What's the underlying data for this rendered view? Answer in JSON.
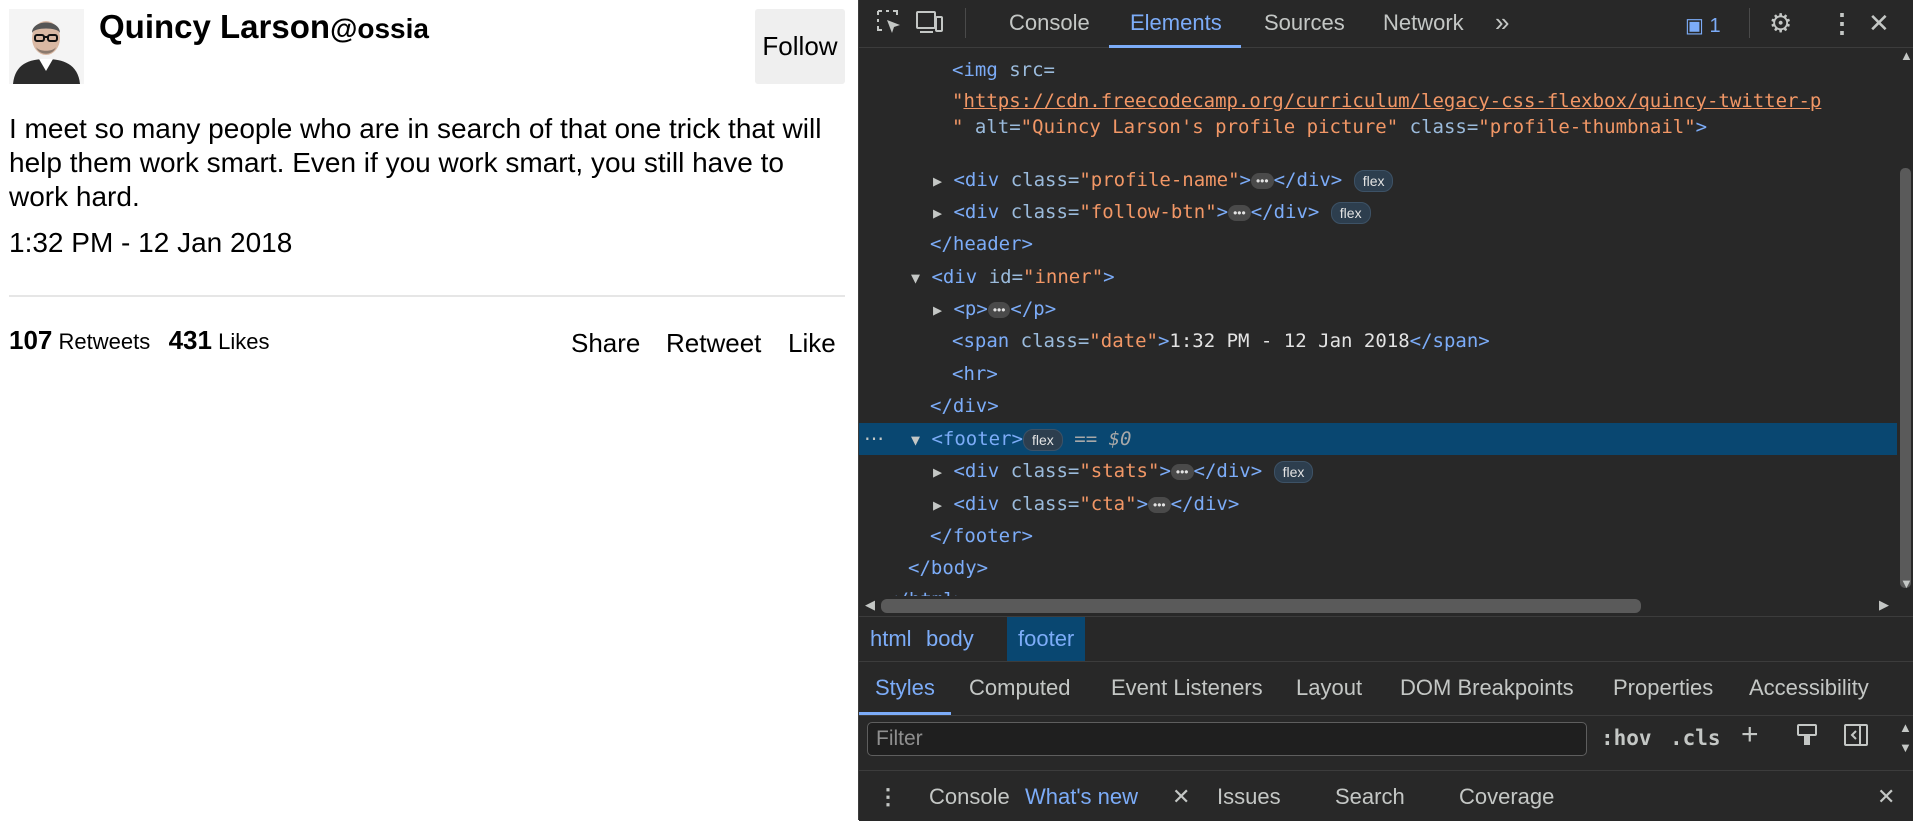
{
  "page": {
    "profile": {
      "name": "Quincy Larson",
      "handle": "@ossia",
      "follow_label": "Follow",
      "avatar_icon": "person-avatar-icon"
    },
    "tweet": "I meet so many people who are in search of that one trick that will help them work smart. Even if you work smart, you still have to work hard.",
    "date": "1:32 PM - 12 Jan 2018",
    "stats": {
      "retweets_count": "107",
      "retweets_label": "Retweets",
      "likes_count": "431",
      "likes_label": "Likes"
    },
    "cta": [
      "Share",
      "Retweet",
      "Like"
    ]
  },
  "devtools": {
    "toolbar": {
      "inspect_icon": "element-picker-icon",
      "device_icon": "device-toolbar-icon",
      "tabs": [
        "Console",
        "Elements",
        "Sources",
        "Network"
      ],
      "active_tab": "Elements",
      "more_tabs_icon": "double-chevron-icon",
      "issues_count": "1",
      "settings_icon": "gear-icon",
      "menu_icon": "kebab-menu-icon",
      "close_icon": "close-icon"
    },
    "dom": {
      "img_src_attr": "src=",
      "img_src_url": "https://cdn.freecodecamp.org/curriculum/legacy-css-flexbox/quincy-twitter-p",
      "img_alt_value": "Quincy Larson's profile picture",
      "img_class_value": "profile-thumbnail",
      "profile_name_class": "profile-name",
      "follow_btn_class": "follow-btn",
      "inner_id": "inner",
      "date_class": "date",
      "date_text": "1:32 PM - 12 Jan 2018",
      "stats_class": "stats",
      "cta_class": "cta",
      "flex_badge": "flex",
      "selected_marker": "== $0"
    },
    "breadcrumbs": [
      "html",
      "body",
      "footer"
    ],
    "styles_tabs": [
      "Styles",
      "Computed",
      "Event Listeners",
      "Layout",
      "DOM Breakpoints",
      "Properties",
      "Accessibility"
    ],
    "filter": {
      "placeholder": "Filter",
      "hov": ":hov",
      "cls": ".cls"
    },
    "drawer_tabs": [
      "Console",
      "What's new",
      "Issues",
      "Search",
      "Coverage"
    ],
    "drawer_active": "What's new"
  },
  "colors": {
    "devtools_bg": "#282828",
    "accent_blue": "#7cacf8",
    "selected_row": "#094771",
    "attr_value": "#f29766"
  }
}
